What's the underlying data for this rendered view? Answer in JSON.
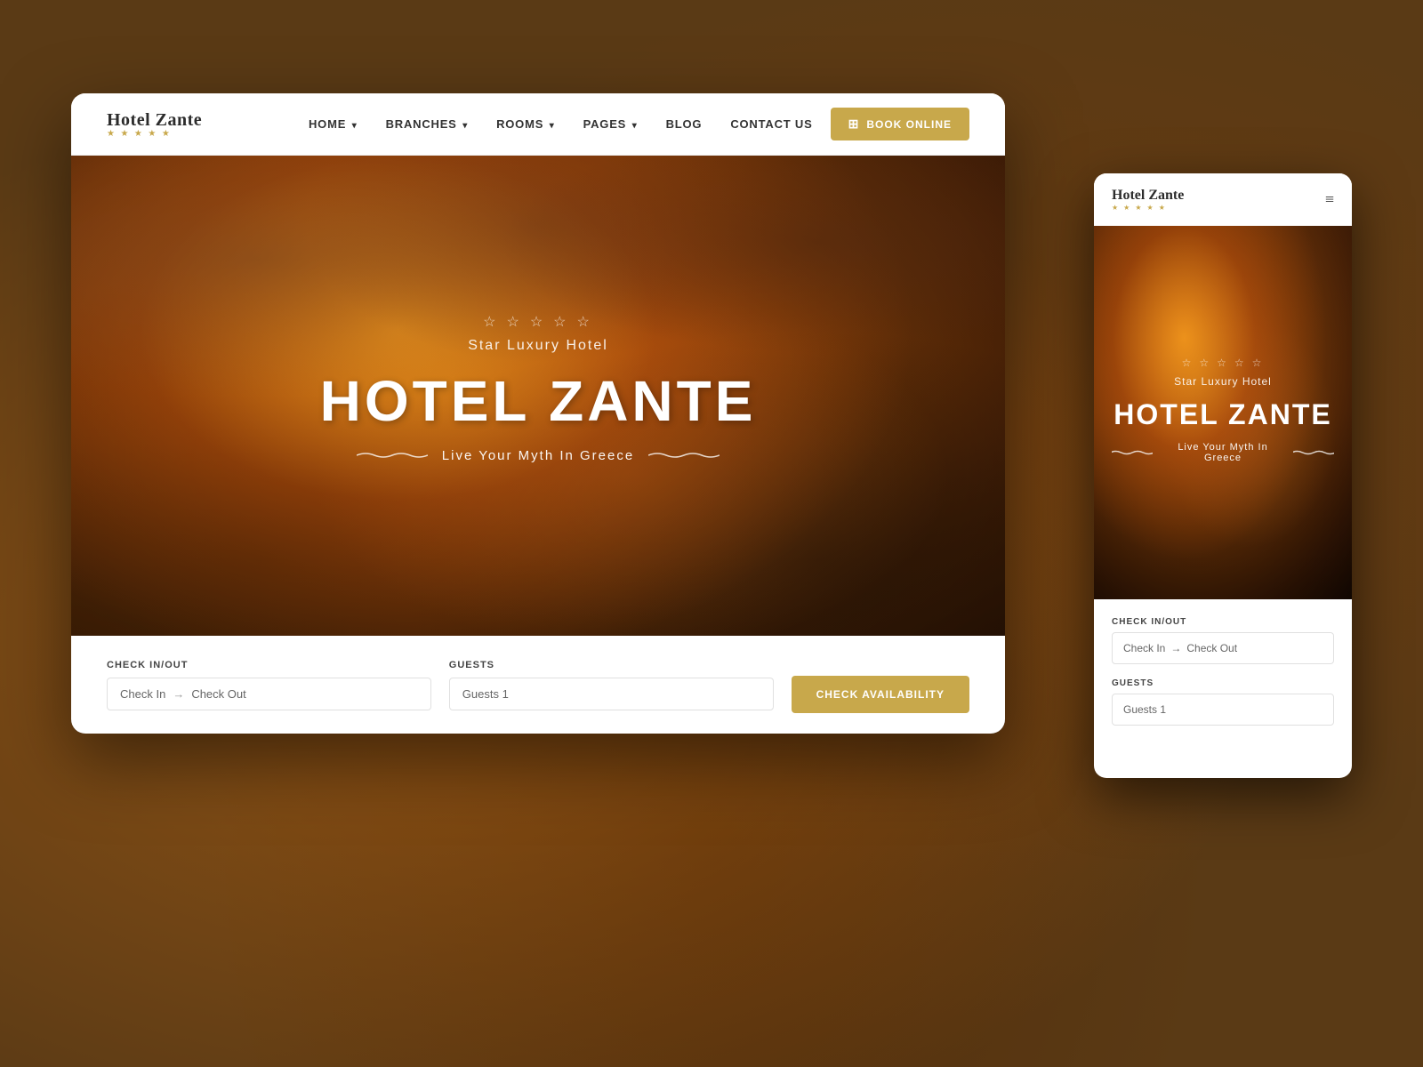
{
  "background": {
    "color": "#5a3a15"
  },
  "desktop": {
    "navbar": {
      "logo": {
        "name": "Hotel Zante",
        "stars": "★ ★ ★ ★ ★"
      },
      "nav_items": [
        {
          "label": "HOME",
          "has_dropdown": true
        },
        {
          "label": "BRANCHES",
          "has_dropdown": true
        },
        {
          "label": "ROOMS",
          "has_dropdown": true
        },
        {
          "label": "PAGES",
          "has_dropdown": true
        },
        {
          "label": "BLOG",
          "has_dropdown": false
        },
        {
          "label": "CONTACT US",
          "has_dropdown": false
        }
      ],
      "book_button": "BOOK ONLINE"
    },
    "hero": {
      "stars": "☆ ☆ ☆ ☆ ☆",
      "subtitle": "Star Luxury Hotel",
      "title": "HOTEL ZANTE",
      "tagline": "Live Your Myth In Greece"
    },
    "booking_bar": {
      "checkin_label": "Check In/Out",
      "checkin_placeholder": "Check In",
      "checkout_placeholder": "Check Out",
      "guests_label": "Guests",
      "guests_value": "Guests 1",
      "button_label": "CHECK AVAILABILITY"
    }
  },
  "mobile": {
    "navbar": {
      "logo": {
        "name": "Hotel Zante",
        "stars": "★ ★ ★ ★ ★"
      },
      "menu_icon": "≡"
    },
    "hero": {
      "stars": "☆ ☆ ☆ ☆ ☆",
      "subtitle": "Star Luxury Hotel",
      "title": "HOTEL ZANTE",
      "tagline": "Live Your Myth In Greece"
    },
    "booking": {
      "checkin_label": "Check In/Out",
      "checkin_placeholder": "Check In",
      "checkout_placeholder": "Check Out",
      "guests_label": "Guests",
      "guests_value": "Guests 1"
    }
  }
}
